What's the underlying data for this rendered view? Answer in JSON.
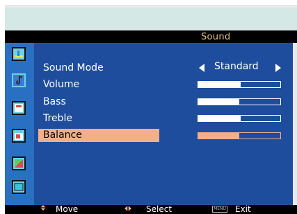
{
  "menu": {
    "title": "Sound"
  },
  "items": [
    {
      "label": "Sound Mode",
      "value": "Standard"
    },
    {
      "label": "Volume",
      "level": 0.52
    },
    {
      "label": "Bass",
      "level": 0.5
    },
    {
      "label": "Treble",
      "level": 0.52
    },
    {
      "label": "Balance",
      "level": 0.5,
      "selected": true
    }
  ],
  "sidebar": {
    "icons": [
      "picture-icon",
      "sound-icon",
      "feature-icon",
      "channel-icon",
      "color-icon",
      "screen-icon"
    ]
  },
  "footer": {
    "move": "Move",
    "select": "Select",
    "menu_key": "MENU",
    "exit": "Exit"
  },
  "colors": {
    "panel": "#1f4d9d",
    "highlight": "#f2b08a",
    "title": "#e2c07b",
    "sidebar": "#2a70c2"
  }
}
